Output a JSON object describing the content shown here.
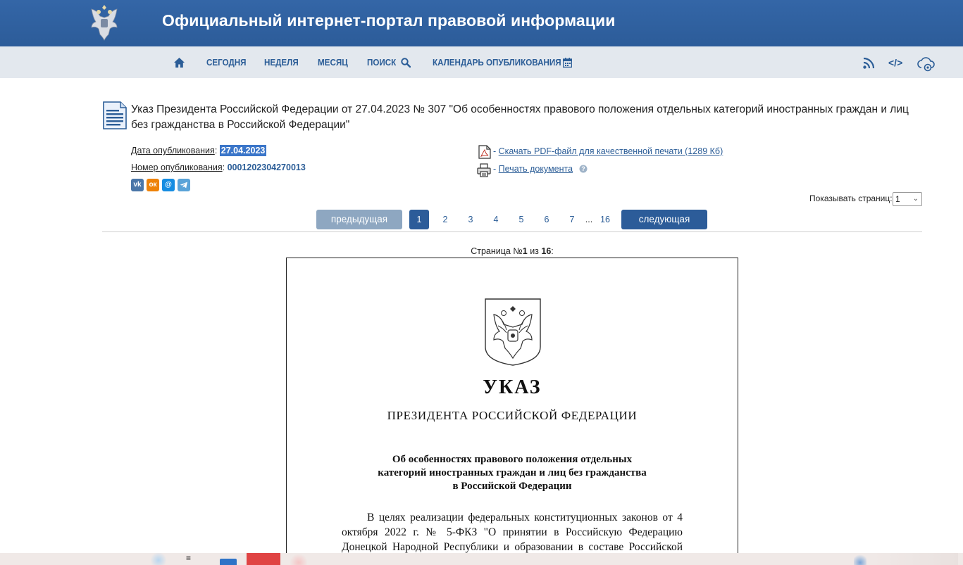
{
  "header": {
    "title": "Официальный интернет-портал правовой информации"
  },
  "nav": {
    "today": "СЕГОДНЯ",
    "week": "НЕДЕЛЯ",
    "month": "МЕСЯЦ",
    "search": "ПОИСК",
    "calendar": "КАЛЕНДАРЬ ОПУБЛИКОВАНИЯ",
    "api": "</>"
  },
  "document": {
    "title": "Указ Президента Российской Федерации от 27.04.2023 № 307 \"Об особенностях правового положения отдельных категорий иностранных граждан и лиц без гражданства в Российской Федерации\"",
    "pub_date_label": "Дата опубликования",
    "pub_date": "27.04.2023",
    "pub_number_label": "Номер опубликования",
    "pub_number": "0001202304270013",
    "colon": ":",
    "pdf_link": "Скачать PDF-файл для качественной печати (1289 Кб)",
    "print_link": "Печать документа",
    "dash": "-"
  },
  "social": [
    "vk-icon",
    "odnoklassniki-icon",
    "moimir-icon",
    "telegram-icon"
  ],
  "pagination": {
    "show_label": "Показывать страниц:",
    "show_value": "1",
    "prev": "предыдущая",
    "next": "следующая",
    "pages": [
      "1",
      "2",
      "3",
      "4",
      "5",
      "6",
      "7",
      "16"
    ],
    "ellipsis": "...",
    "counter_prefix": "Страница №",
    "current": "1",
    "counter_mid": "из",
    "total": "16",
    "counter_suffix": ":"
  },
  "page_content": {
    "heading": "УКАЗ",
    "subheading": "ПРЕЗИДЕНТА РОССИЙСКОЙ ФЕДЕРАЦИИ",
    "subject_lines": [
      "Об особенностях правового положения отдельных",
      "категорий иностранных граждан и лиц без гражданства",
      "в Российской Федерации"
    ],
    "body": "В целях реализации федеральных конституционных законов от 4 октября 2022 г. № 5-ФКЗ \"О принятии в Российскую Федерацию Донецкой Народной Республики и образовании в составе Российской Федерации нового субъекта - Донецкой Народной Республики\""
  },
  "colors": {
    "header_blue": "#2f5f9e",
    "nav_bg": "#e3e8ee",
    "link_blue": "#2b5d97",
    "prev_btn": "#8ea7c1",
    "highlight": "#3b76c9"
  }
}
